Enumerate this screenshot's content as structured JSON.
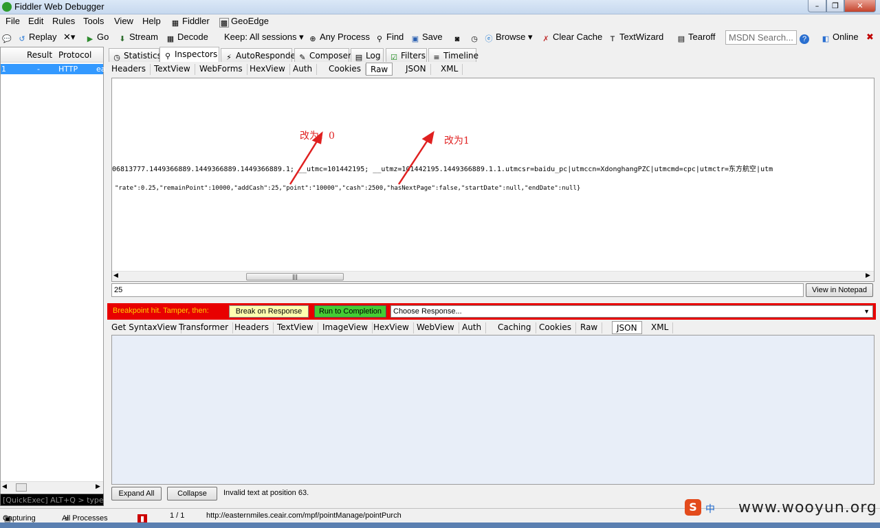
{
  "window": {
    "title": "Fiddler Web Debugger",
    "min": "–",
    "max": "❐",
    "close": "✕"
  },
  "menu": [
    "File",
    "Edit",
    "Rules",
    "Tools",
    "View",
    "Help",
    "Fiddler",
    "GeoEdge"
  ],
  "toolbar": {
    "replay": "Replay",
    "remove": "✕▾",
    "go": "Go",
    "stream": "Stream",
    "decode": "Decode",
    "keep": "Keep: All sessions ▾",
    "any_process": "Any Process",
    "find": "Find",
    "save": "Save",
    "browse": "Browse ▾",
    "clear_cache": "Clear Cache",
    "textwizard": "TextWizard",
    "tearoff": "Tearoff",
    "msdn_placeholder": "MSDN Search...",
    "online": "Online",
    "close_x": "✖"
  },
  "sessions": {
    "columns": [
      "Result",
      "Protocol"
    ],
    "rows": [
      {
        "id": "1",
        "result": "-",
        "protocol": "HTTP",
        "host": "ea"
      }
    ],
    "quickexec": "[QuickExec] ALT+Q > type HE"
  },
  "main_tabs": [
    "Statistics",
    "Inspectors",
    "AutoResponder",
    "Composer",
    "Log",
    "Filters",
    "Timeline"
  ],
  "request_tabs": [
    "Headers",
    "TextView",
    "WebForms",
    "HexView",
    "Auth",
    "Cookies",
    "Raw",
    "JSON",
    "XML"
  ],
  "request_body": {
    "line1": "06813777.1449366889.1449366889.1449366889.1; __utmc=101442195; __utmz=101442195.1449366889.1.1.utmcsr=baidu_pc|utmccn=XdonghangPZC|utmcmd=cpc|utmctr=东方航空|utm",
    "line2": "\"rate\":0.25,\"remainPoint\":10000,\"addCash\":25,\"point\":\"10000\",\"cash\":2500,\"hasNextPage\":false,\"startDate\":null,\"endDate\":null}"
  },
  "annotations": {
    "left": "改为：0",
    "right": "改为1"
  },
  "find_value": "25",
  "view_notepad": "View in Notepad",
  "breakpoint": {
    "message": "Breakpoint hit. Tamper, then:",
    "break_on_response": "Break on Response",
    "run_to_completion": "Run to Completion",
    "choose_response": "Choose Response..."
  },
  "response_tabs": [
    "Get SyntaxView",
    "Transformer",
    "Headers",
    "TextView",
    "ImageView",
    "HexView",
    "WebView",
    "Auth",
    "Caching",
    "Cookies",
    "Raw",
    "JSON",
    "XML"
  ],
  "response_actions": {
    "expand": "Expand All",
    "collapse": "Collapse",
    "status": "Invalid text at position 63."
  },
  "status_bar": {
    "capturing": "Capturing",
    "processes": "All Processes",
    "count": "1 / 1",
    "url": "http://easternmiles.ceair.com/mpf/pointManage/pointPurch"
  },
  "watermark": {
    "logo": "S",
    "cn": "中",
    "site": "www.wooyun.org"
  },
  "colors": {
    "breakpoint_bar": "#e80000",
    "selected_row": "#3399ff",
    "run_btn": "#44cc33",
    "break_btn": "#ffffb0",
    "annotation": "#e02020"
  }
}
